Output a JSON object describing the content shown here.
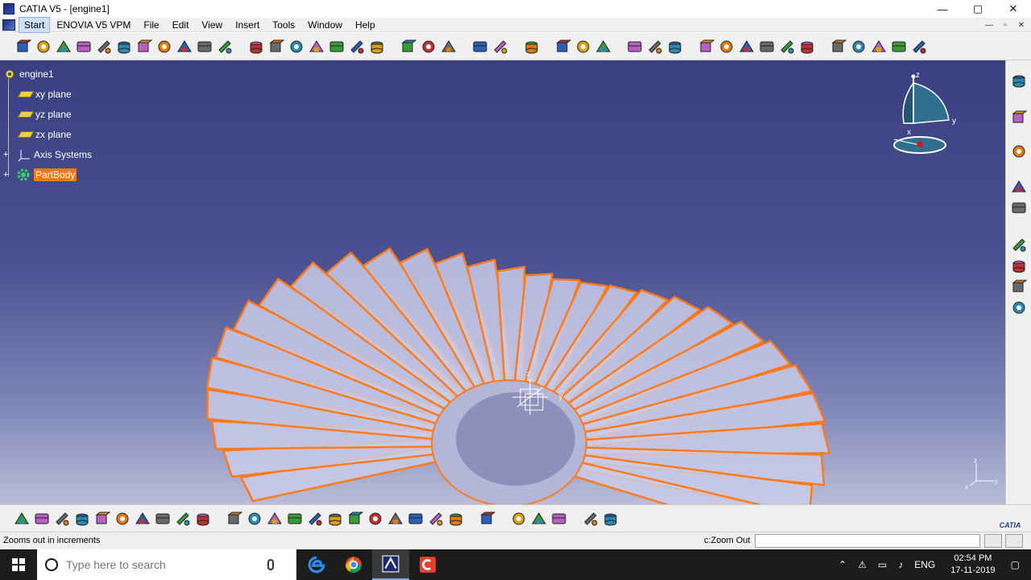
{
  "window": {
    "title": "CATIA V5 - [engine1]",
    "controls": {
      "minimize": "—",
      "maximize": "▢",
      "close": "✕"
    }
  },
  "menubar": {
    "items": [
      "Start",
      "ENOVIA V5 VPM",
      "File",
      "Edit",
      "View",
      "Insert",
      "Tools",
      "Window",
      "Help"
    ],
    "doc_controls": [
      "—",
      "▫",
      "✕"
    ]
  },
  "tree": {
    "root": "engine1",
    "children": [
      "xy plane",
      "yz plane",
      "zx plane",
      "Axis Systems",
      "PartBody"
    ],
    "selected": "PartBody"
  },
  "compass": {
    "axis_x": "x",
    "axis_y": "y",
    "axis_z": "z"
  },
  "mini_axes": {
    "axis_x": "x",
    "axis_y": "y",
    "axis_z": "z"
  },
  "model": {
    "blade_color": "#ff7a1a",
    "blade_fill": "#c9cbe8",
    "blade_count": 30
  },
  "status": {
    "message": "Zooms out in increments",
    "command_label": "c:Zoom Out",
    "command_value": ""
  },
  "brand": {
    "logo_text": "CATIA"
  },
  "taskbar": {
    "search_placeholder": "Type here to search",
    "language": "ENG",
    "time": "02:54 PM",
    "date": "17-11-2019"
  },
  "colors": {
    "viewport_top": "#3a3f7f",
    "viewport_bottom": "#b9bdd8",
    "selection": "#f07a10",
    "taskbar": "#1c1c1c"
  },
  "icons": {
    "top_toolbar": [
      "sketcher-icon",
      "positioned-sketch-icon",
      "pad-icon",
      "pocket-icon",
      "shaft-icon",
      "groove-icon",
      "hole-icon",
      "rib-icon",
      "slot-icon",
      "stiffener-icon",
      "loft-icon",
      "fillet-icon",
      "chamfer-icon",
      "draft-icon",
      "shell-icon",
      "thickness-icon",
      "thread-icon",
      "split-icon",
      "thick-surface-icon",
      "close-surface-icon",
      "sew-surface-icon",
      "translate-icon",
      "rotate-icon",
      "symmetry-icon",
      "mirror-icon",
      "pattern-icon",
      "scale-icon",
      "boolean-icon",
      "assemble-icon",
      "add-icon",
      "remove-icon",
      "intersect-icon",
      "measure-icon",
      "inertia-icon",
      "apply-material-icon",
      "constraint-icon",
      "analysis-icon",
      "axis-icon",
      "point-icon",
      "line-icon",
      "plane-icon"
    ],
    "bottom_toolbar": [
      "new-icon",
      "open-icon",
      "save-icon",
      "print-icon",
      "cut-icon",
      "copy-icon",
      "paste-icon",
      "undo-icon",
      "redo-icon",
      "help-icon",
      "fly-mode-icon",
      "fit-all-icon",
      "pan-icon",
      "rotate-view-icon",
      "zoom-in-icon",
      "zoom-out-icon",
      "normal-view-icon",
      "quick-view-icon",
      "view-mode-icon",
      "hide-show-icon",
      "swap-visible-icon",
      "update-icon",
      "spec-tree-icon",
      "knowledge-icon",
      "capture-icon",
      "material-icon",
      "publish-icon",
      "tools-icon"
    ],
    "right_toolbar": [
      "wireframe-icon",
      "select-icon",
      "sketch-analysis-icon",
      "spec-icon",
      "surface-icon",
      "solid-icon",
      "pad-surface-icon",
      "extrude-icon",
      "boundary-icon"
    ]
  }
}
